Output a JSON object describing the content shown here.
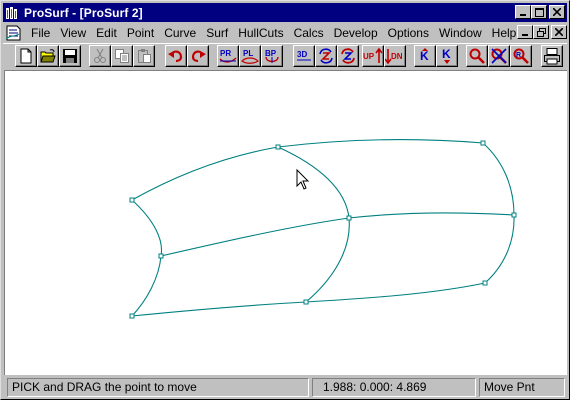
{
  "window": {
    "title": "ProSurf - [ProSurf 2]"
  },
  "menu": [
    {
      "label": "File"
    },
    {
      "label": "View"
    },
    {
      "label": "Edit"
    },
    {
      "label": "Point"
    },
    {
      "label": "Curve"
    },
    {
      "label": "Surf"
    },
    {
      "label": "HullCuts"
    },
    {
      "label": "Calcs"
    },
    {
      "label": "Develop"
    },
    {
      "label": "Options"
    },
    {
      "label": "Window"
    },
    {
      "label": "Help"
    }
  ],
  "toolbar": {
    "tools": [
      {
        "name": "new-file-icon"
      },
      {
        "name": "open-folder-icon"
      },
      {
        "name": "save-disk-icon"
      },
      {
        "name": "cut-scissors-icon"
      },
      {
        "name": "copy-icon"
      },
      {
        "name": "paste-icon"
      },
      {
        "name": "undo-icon"
      },
      {
        "name": "redo-icon"
      },
      {
        "name": "profile-view-icon",
        "text": "PR"
      },
      {
        "name": "plan-view-icon",
        "text": "PL"
      },
      {
        "name": "body-plan-icon",
        "text": "BP"
      },
      {
        "name": "3d-view-icon",
        "text": "3D"
      },
      {
        "name": "rotate-z-icon"
      },
      {
        "name": "rotate-alt-icon"
      },
      {
        "name": "rotate-up-icon",
        "text": "UP"
      },
      {
        "name": "rotate-down-icon",
        "text": "DN"
      },
      {
        "name": "k-up-icon",
        "text": "K"
      },
      {
        "name": "k-down-icon",
        "text": "K"
      },
      {
        "name": "zoom-icon"
      },
      {
        "name": "zoom-cancel-icon"
      },
      {
        "name": "zoom-reset-icon"
      },
      {
        "name": "print-icon"
      }
    ]
  },
  "status": {
    "message": "PICK and DRAG the point to move",
    "coordinates": "1.988:  0.000:  4.869",
    "mode": "Move Pnt"
  },
  "colors": {
    "title_bar": "#000080",
    "curve": "#008080",
    "canvas": "#ffffff"
  }
}
